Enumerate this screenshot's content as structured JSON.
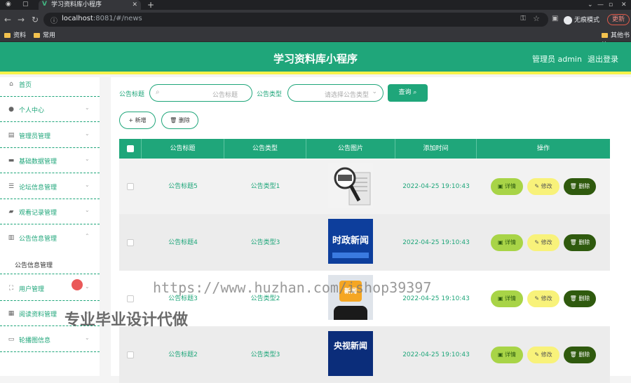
{
  "browser": {
    "tab_title": "学习资料库小程序",
    "url_host": "localhost",
    "url_rest": ":8081/#/news",
    "profile": "无痕模式",
    "update_label": "更新",
    "bookmarks": [
      "资料",
      "常用",
      "其他书签"
    ]
  },
  "header": {
    "title": "学习资料库小程序",
    "admin_label": "管理员 admin",
    "logout_label": "退出登录"
  },
  "sidebar": {
    "items": [
      {
        "label": "首页",
        "icon": "home-icon"
      },
      {
        "label": "个人中心",
        "icon": "user-icon"
      },
      {
        "label": "管理员管理",
        "icon": "chart-icon"
      },
      {
        "label": "基础数据管理",
        "icon": "chat-icon"
      },
      {
        "label": "论坛信息管理",
        "icon": "sliders-icon"
      },
      {
        "label": "观看记录管理",
        "icon": "briefcase-icon"
      },
      {
        "label": "公告信息管理",
        "icon": "clipboard-icon"
      },
      {
        "label": "用户管理",
        "icon": "frame-icon"
      },
      {
        "label": "阅读资料管理",
        "icon": "doc-icon"
      },
      {
        "label": "轮播图信息",
        "icon": "monitor-icon"
      }
    ],
    "sub_item": "公告信息管理"
  },
  "filters": {
    "title_label": "公告标题",
    "title_placeholder": "公告标题",
    "type_label": "公告类型",
    "type_placeholder": "请选择公告类型",
    "query_label": "查询",
    "add_label": "新增",
    "delete_label": "删除"
  },
  "table": {
    "headers": [
      "公告标题",
      "公告类型",
      "公告图片",
      "添加时间",
      "操作"
    ],
    "rows": [
      {
        "title": "公告标题5",
        "type": "公告类型1",
        "time": "2022-04-25 19:10:43",
        "image_text": ""
      },
      {
        "title": "公告标题4",
        "type": "公告类型3",
        "time": "2022-04-25 19:10:43",
        "image_text": "时政新闻"
      },
      {
        "title": "公告标题3",
        "type": "公告类型2",
        "time": "2022-04-25 19:10:43",
        "image_text": "新闻"
      },
      {
        "title": "公告标题2",
        "type": "公告类型3",
        "time": "2022-04-25 19:10:43",
        "image_text": "央视新闻"
      }
    ],
    "ops": {
      "detail": "详情",
      "edit": "修改",
      "delete": "删除"
    }
  },
  "overlay": {
    "watermark": "https://www.huzhan.com/ishop39397",
    "promo": "专业毕业设计代做"
  },
  "colors": {
    "primary": "#1fa67a",
    "accent_yellow": "#f7f24a",
    "detail_green": "#a8d447",
    "delete_dark": "#2f5a0e"
  }
}
